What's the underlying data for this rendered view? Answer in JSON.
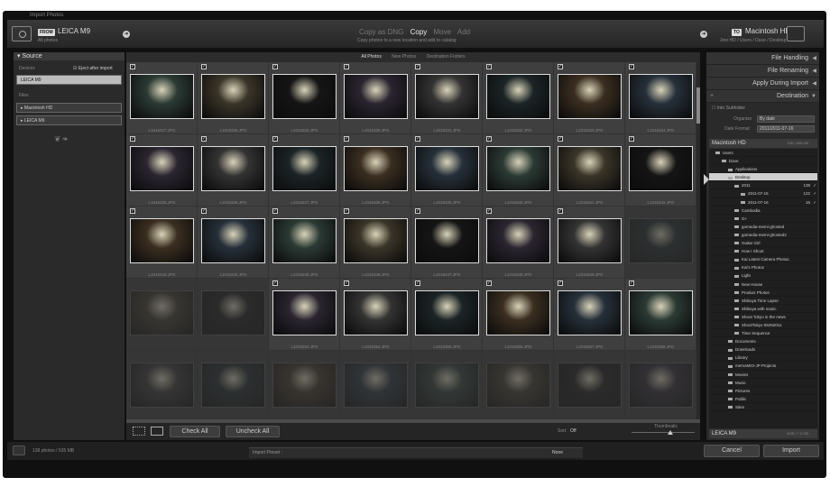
{
  "window": {
    "title": "Import Photos"
  },
  "from": {
    "tag": "FROM",
    "device": "LEICA M9",
    "sub": "All photos"
  },
  "modes": {
    "items": [
      "Copy as DNG",
      "Copy",
      "Move",
      "Add"
    ],
    "active": "Copy",
    "description": "Copy photos to a new location and add to catalog"
  },
  "to": {
    "tag": "TO",
    "device": "Macintosh HD",
    "path": "Jinn HD / Users / Dave / Desktop"
  },
  "source": {
    "title": "Source",
    "devices_label": "Devices",
    "eject_label": "Eject after import",
    "device": "LEICA M9",
    "files_label": "Files",
    "files": [
      "Macintosh HD",
      "LEICA M9"
    ]
  },
  "view_tabs": {
    "items": [
      "All Photos",
      "New Photos",
      "Destination Folders"
    ],
    "active": "All Photos"
  },
  "grid": {
    "rows": [
      [
        "L1016327.JPG",
        "L1016328.JPG",
        "L1016329.JPG",
        "L1016330.JPG",
        "L1016331.JPG",
        "L1016332.JPG",
        "L1016333.JPG",
        "L1016334.JPG"
      ],
      [
        "L1016335.JPG",
        "L1016336.JPG",
        "L1016337.JPG",
        "L1016338.JPG",
        "L1016339.JPG",
        "L1016340.JPG",
        "L1016341.JPG",
        "L1016342.JPG"
      ],
      [
        "L1016343.JPG",
        "L1016344.JPG",
        "L1016345.JPG",
        "L1016346.JPG",
        "L1016347.JPG",
        "L1016348.JPG",
        "L1016349.JPG",
        ""
      ],
      [
        "",
        "",
        "L1016353.JPG",
        "L1016354.JPG",
        "L1016355.JPG",
        "L1016356.JPG",
        "L1016357.JPG",
        "L1016358.JPG"
      ],
      [
        "",
        "",
        "",
        "",
        "",
        "",
        "",
        ""
      ]
    ]
  },
  "bottom": {
    "check_all": "Check All",
    "uncheck_all": "Uncheck All",
    "sort_label": "Sort:",
    "sort_value": "Off",
    "thumbnails_label": "Thumbnails"
  },
  "right": {
    "sections": [
      "File Handling",
      "File Renaming",
      "Apply During Import",
      "Destination"
    ],
    "into_subfolder": "Into Subfolder",
    "organize_label": "Organize",
    "organize_value": "By date",
    "date_format_label": "Date Format",
    "date_format_value": "2011/2011-07-16",
    "volume": "Macintosh HD",
    "volume_free": "106 / 465 GB",
    "tree": [
      {
        "label": "Users",
        "indent": 1
      },
      {
        "label": "Dave",
        "indent": 2
      },
      {
        "label": "Applications",
        "indent": 3
      },
      {
        "label": "Desktop",
        "indent": 3,
        "selected": true
      },
      {
        "label": "2011",
        "indent": 4,
        "count": "138",
        "check": "✓"
      },
      {
        "label": "2011-07-15",
        "indent": 5,
        "count": "122",
        "check": "✓"
      },
      {
        "label": "2011-07-16",
        "indent": 5,
        "count": "16",
        "check": "✓"
      },
      {
        "label": "Cambodia",
        "indent": 4
      },
      {
        "label": "G+",
        "indent": 4
      },
      {
        "label": "gomedia-memi-ghosted",
        "indent": 4
      },
      {
        "label": "gomedia-memi-ghosted2",
        "indent": 4
      },
      {
        "label": "Guitar Girl",
        "indent": 4
      },
      {
        "label": "How I Shoot",
        "indent": 4
      },
      {
        "label": "Kai Latest Camera Photos",
        "indent": 4
      },
      {
        "label": "Kai's Photos",
        "indent": 4
      },
      {
        "label": "Light",
        "indent": 4
      },
      {
        "label": "New House",
        "indent": 4
      },
      {
        "label": "Product Photos",
        "indent": 4
      },
      {
        "label": "Shibuya Time Lapse",
        "indent": 4
      },
      {
        "label": "Shibuya with music",
        "indent": 4
      },
      {
        "label": "Shoot Tokyo in the news",
        "indent": 4
      },
      {
        "label": "ShootTokyo 05292011",
        "indent": 4
      },
      {
        "label": "Time Sequence",
        "indent": 4
      },
      {
        "label": "Documents",
        "indent": 3
      },
      {
        "label": "Downloads",
        "indent": 3
      },
      {
        "label": "Library",
        "indent": 3
      },
      {
        "label": "memoMIO-JP Projects",
        "indent": 3
      },
      {
        "label": "Movies",
        "indent": 3
      },
      {
        "label": "Music",
        "indent": 3
      },
      {
        "label": "Pictures",
        "indent": 3
      },
      {
        "label": "Public",
        "indent": 3
      },
      {
        "label": "Sites",
        "indent": 3
      }
    ],
    "volume2": "LEICA M9",
    "volume2_free": "4GB / 7.3 GB"
  },
  "footer": {
    "summary": "138 photos / 535 MB",
    "preset_label": "Import Preset :",
    "preset_value": "None",
    "cancel": "Cancel",
    "import": "Import"
  }
}
